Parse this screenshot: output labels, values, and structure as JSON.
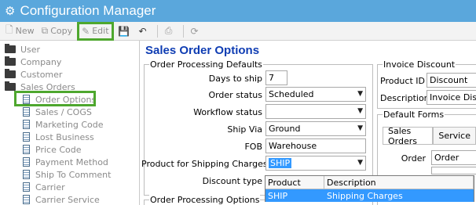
{
  "window": {
    "title": "Configuration Manager"
  },
  "toolbar": {
    "new_label": "New",
    "copy_label": "Copy",
    "edit_label": "Edit",
    "accent": "#4ea72e"
  },
  "tree": {
    "items": [
      {
        "label": "User",
        "kind": "folder"
      },
      {
        "label": "Company",
        "kind": "folder"
      },
      {
        "label": "Customer",
        "kind": "folder"
      },
      {
        "label": "Sales Orders",
        "kind": "folder-open"
      },
      {
        "label": "Order Options",
        "kind": "doc"
      },
      {
        "label": "Sales / COGS",
        "kind": "doc"
      },
      {
        "label": "Marketing Code",
        "kind": "doc"
      },
      {
        "label": "Lost Business",
        "kind": "doc"
      },
      {
        "label": "Price Code",
        "kind": "doc"
      },
      {
        "label": "Payment Method",
        "kind": "doc"
      },
      {
        "label": "Ship To Comment",
        "kind": "doc"
      },
      {
        "label": "Carrier",
        "kind": "doc"
      },
      {
        "label": "Carrier Service",
        "kind": "doc"
      }
    ]
  },
  "main": {
    "title": "Sales Order Options",
    "processing_defaults": {
      "legend": "Order Processing Defaults",
      "days_to_ship_label": "Days to ship",
      "days_to_ship_value": "7",
      "order_status_label": "Order status",
      "order_status_value": "Scheduled",
      "workflow_status_label": "Workflow status",
      "workflow_status_value": "",
      "ship_via_label": "Ship Via",
      "ship_via_value": "Ground",
      "fob_label": "FOB",
      "fob_value": "Warehouse",
      "shipping_product_label": "Product for Shipping Charges",
      "shipping_product_value": "SHIP",
      "discount_type_label": "Discount type"
    },
    "processing_options": {
      "legend": "Order Processing Options"
    },
    "invoice_discount": {
      "legend": "Invoice Discount",
      "product_id_label": "Product ID",
      "product_id_value": "Discount",
      "description_label": "Description",
      "description_value": "Invoice Disco"
    },
    "default_forms": {
      "legend": "Default Forms",
      "tabs": [
        "Sales Orders",
        "Service"
      ],
      "order_label": "Order",
      "order_value": "Order"
    },
    "dropdown": {
      "col_product": "Product",
      "col_description": "Description",
      "row_product": "SHIP",
      "row_description": "Shipping Charges"
    }
  }
}
